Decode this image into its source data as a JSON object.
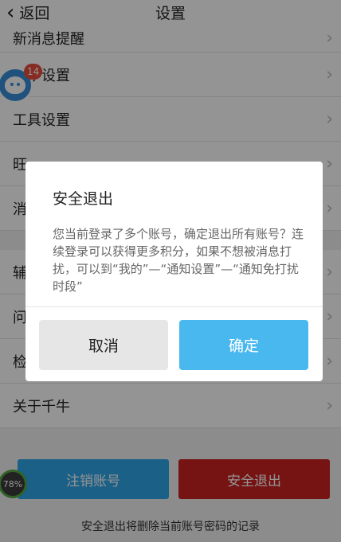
{
  "header": {
    "back_label": "返回",
    "title": "设置"
  },
  "settings": {
    "items": [
      {
        "label": "新消息提醒"
      },
      {
        "label": "数字设置"
      },
      {
        "label": "工具设置"
      },
      {
        "label": "旺"
      },
      {
        "label": "消"
      },
      {
        "label": "辅"
      },
      {
        "label": "问"
      },
      {
        "label": "检"
      },
      {
        "label": "关于千牛"
      }
    ]
  },
  "floating": {
    "badge_count": "14"
  },
  "progress": {
    "value": "78%"
  },
  "bottom": {
    "cancel_account_label": "注销账号",
    "logout_label": "安全退出",
    "note": "安全退出将删除当前账号密码的记录"
  },
  "dialog": {
    "title": "安全退出",
    "message": "您当前登录了多个账号，确定退出所有账号？连续登录可以获得更多积分，如果不想被消息打扰，可以到“我的”—“通知设置”—“通知免打扰时段”",
    "cancel_label": "取消",
    "confirm_label": "确定"
  },
  "colors": {
    "accent": "#49b8ef",
    "danger": "#cc2222",
    "badge": "#e74c3c"
  }
}
